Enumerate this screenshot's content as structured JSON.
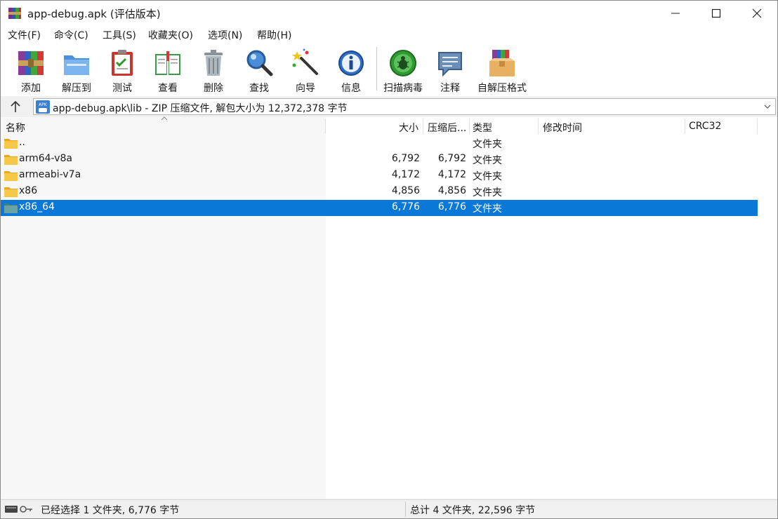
{
  "window": {
    "title": "app-debug.apk (评估版本)"
  },
  "menu": [
    {
      "label": "文件(F)"
    },
    {
      "label": "命令(C)"
    },
    {
      "label": "工具(S)"
    },
    {
      "label": "收藏夹(O)"
    },
    {
      "label": "选项(N)"
    },
    {
      "label": "帮助(H)"
    }
  ],
  "toolbar": [
    {
      "label": "添加",
      "icon": "add-archive-icon"
    },
    {
      "label": "解压到",
      "icon": "extract-folder-icon"
    },
    {
      "label": "测试",
      "icon": "test-clipboard-icon"
    },
    {
      "label": "查看",
      "icon": "view-book-icon"
    },
    {
      "label": "删除",
      "icon": "trash-icon"
    },
    {
      "label": "查找",
      "icon": "magnifier-icon"
    },
    {
      "label": "向导",
      "icon": "wizard-wand-icon"
    },
    {
      "label": "信息",
      "icon": "info-icon"
    },
    {
      "label": "扫描病毒",
      "icon": "virus-scan-icon"
    },
    {
      "label": "注释",
      "icon": "comment-icon"
    },
    {
      "label": "自解压格式",
      "icon": "sfx-archive-icon"
    }
  ],
  "address": {
    "path": "app-debug.apk\\lib - ZIP 压缩文件, 解包大小为 12,372,378 字节"
  },
  "columns": {
    "name": "名称",
    "size": "大小",
    "packed": "压缩后...",
    "type": "类型",
    "modified": "修改时间",
    "crc": "CRC32"
  },
  "rows": [
    {
      "name": "..",
      "size": "",
      "packed": "",
      "type": "文件夹",
      "selected": false
    },
    {
      "name": "arm64-v8a",
      "size": "6,792",
      "packed": "6,792",
      "type": "文件夹",
      "selected": false
    },
    {
      "name": "armeabi-v7a",
      "size": "4,172",
      "packed": "4,172",
      "type": "文件夹",
      "selected": false
    },
    {
      "name": "x86",
      "size": "4,856",
      "packed": "4,856",
      "type": "文件夹",
      "selected": false
    },
    {
      "name": "x86_64",
      "size": "6,776",
      "packed": "6,776",
      "type": "文件夹",
      "selected": true
    }
  ],
  "status": {
    "selection": "已经选择 1 文件夹, 6,776 字节",
    "total": "总计 4 文件夹, 22,596 字节"
  },
  "colors": {
    "selection": "#0a78d7",
    "folder": "#f7c042"
  }
}
